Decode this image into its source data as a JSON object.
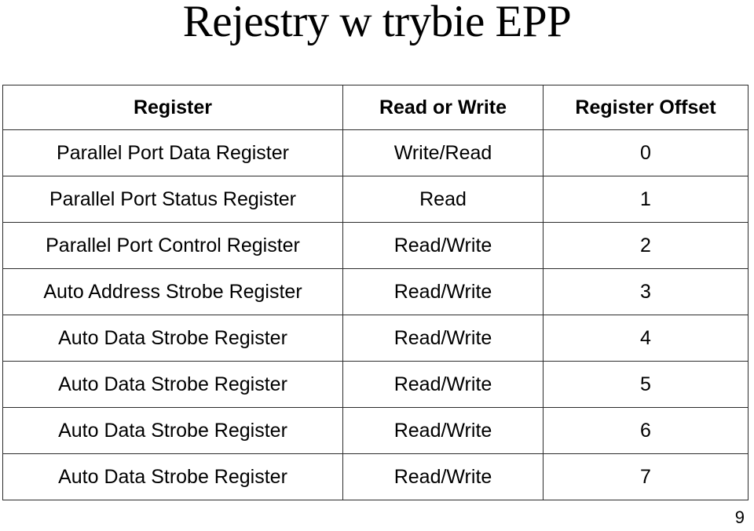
{
  "slide": {
    "title": "Rejestry w trybie EPP",
    "page_number": "9"
  },
  "table": {
    "headers": {
      "register": "Register",
      "read_or_write": "Read or Write",
      "register_offset": "Register Offset"
    },
    "rows": [
      {
        "register": "Parallel Port Data Register",
        "read_or_write": "Write/Read",
        "register_offset": "0"
      },
      {
        "register": "Parallel Port Status Register",
        "read_or_write": "Read",
        "register_offset": "1"
      },
      {
        "register": "Parallel Port Control Register",
        "read_or_write": "Read/Write",
        "register_offset": "2"
      },
      {
        "register": "Auto Address Strobe Register",
        "read_or_write": "Read/Write",
        "register_offset": "3"
      },
      {
        "register": "Auto Data Strobe Register",
        "read_or_write": "Read/Write",
        "register_offset": "4"
      },
      {
        "register": "Auto Data Strobe Register",
        "read_or_write": "Read/Write",
        "register_offset": "5"
      },
      {
        "register": "Auto Data Strobe Register",
        "read_or_write": "Read/Write",
        "register_offset": "6"
      },
      {
        "register": "Auto Data Strobe Register",
        "read_or_write": "Read/Write",
        "register_offset": "7"
      }
    ]
  },
  "colors": {
    "text": "#000000",
    "border": "#2b2b2b",
    "background": "#ffffff"
  }
}
